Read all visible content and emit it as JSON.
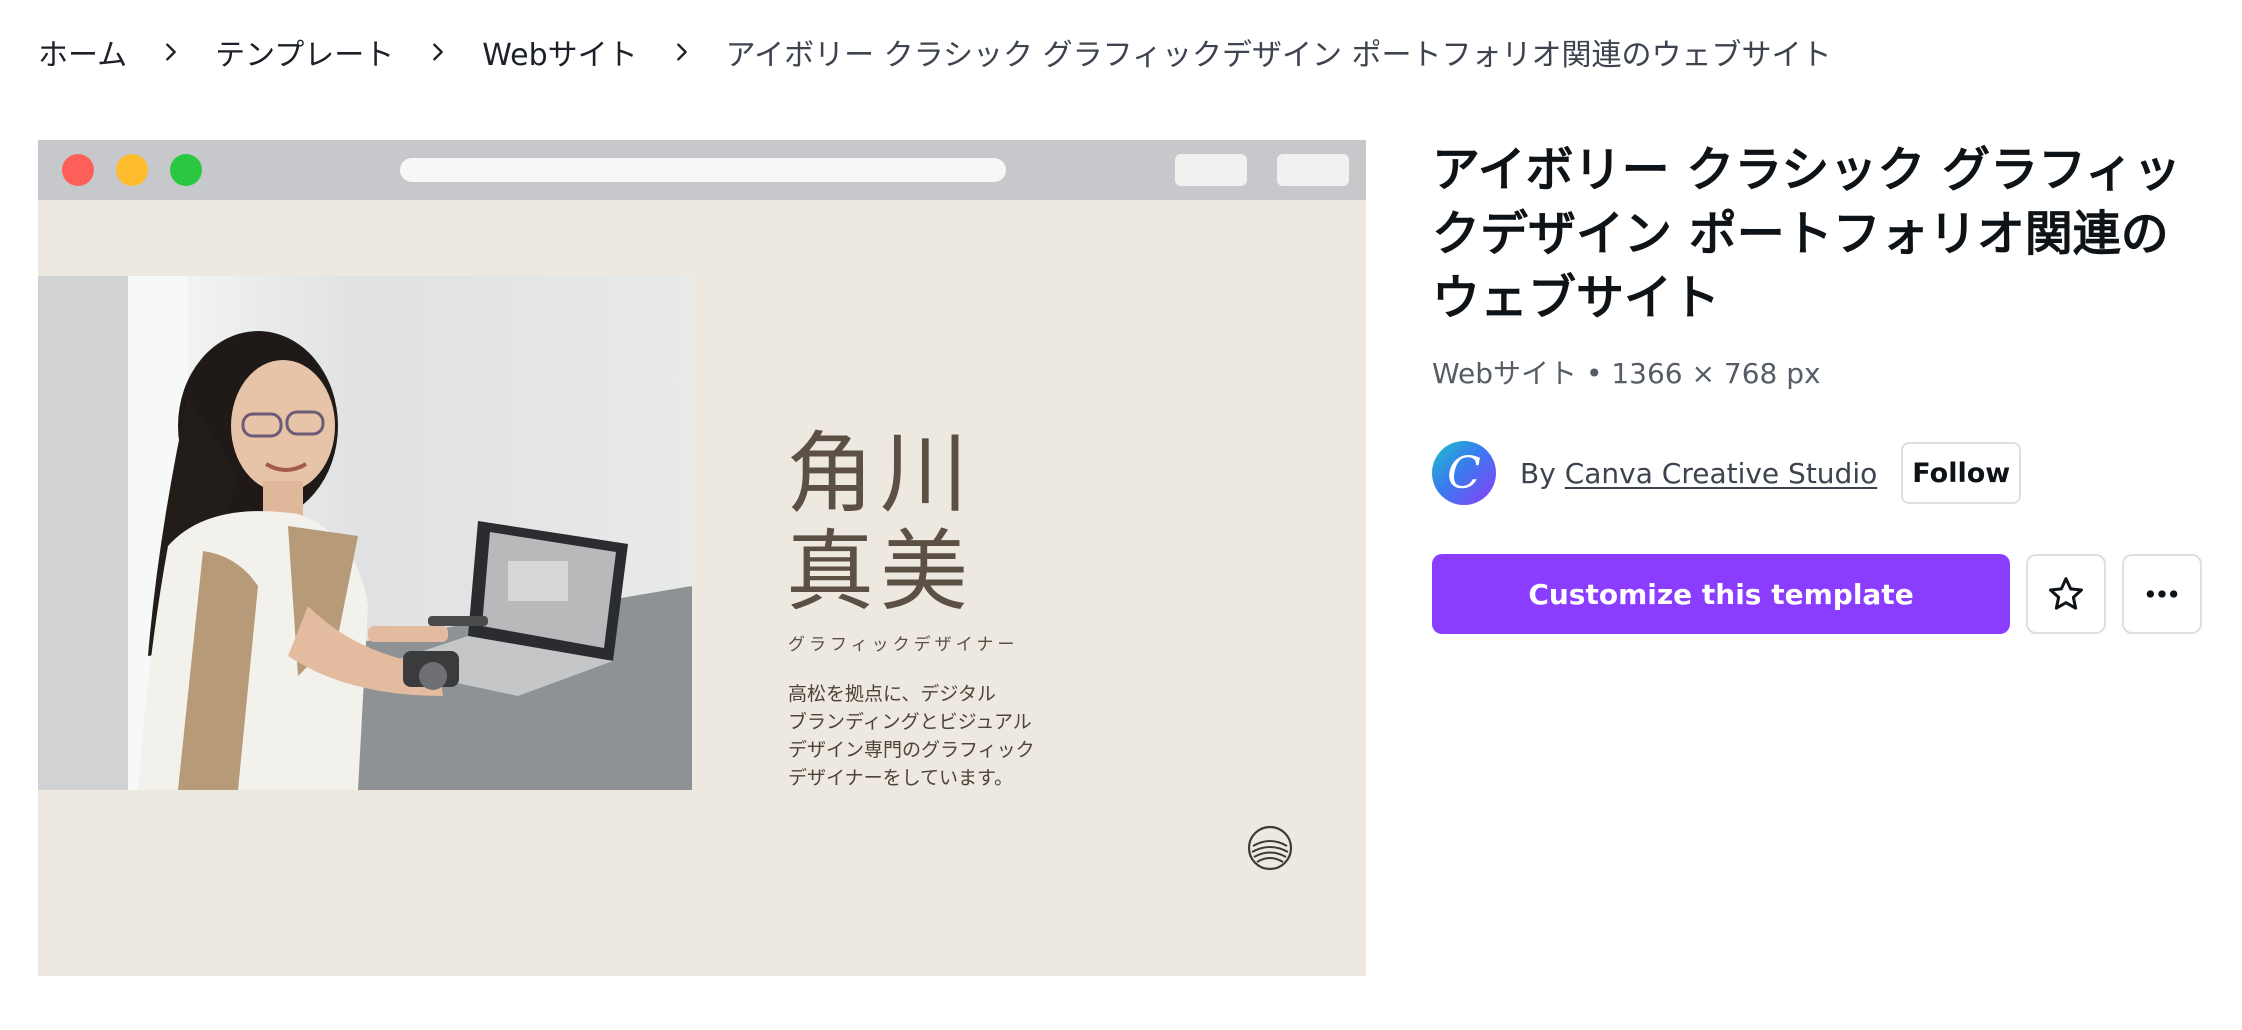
{
  "breadcrumb": {
    "items": [
      "ホーム",
      "テンプレート",
      "Webサイト",
      "アイボリー クラシック グラフィックデザイン ポートフォリオ関連のウェブサイト"
    ]
  },
  "preview": {
    "name_line1": "角川",
    "name_line2": "真美",
    "role": "グラフィックデザイナー",
    "bio_lines": [
      "高松を拠点に、デジタル",
      "ブランディングとビジュアル",
      "デザイン専門のグラフィック",
      "デザイナーをしています。"
    ]
  },
  "template": {
    "title_lines": [
      "アイボリー クラシック グラフィッ",
      "クデザイン ポートフォリオ関連の",
      "ウェブサイト"
    ],
    "meta": "Webサイト • 1366 × 768 px"
  },
  "author": {
    "avatar_letter": "C",
    "by": "By ",
    "name": "Canva Creative Studio",
    "follow_label": "Follow"
  },
  "actions": {
    "customize_label": "Customize this template",
    "favorite_icon": "star-icon",
    "more_icon": "more-horizontal-icon"
  },
  "colors": {
    "accent": "#8b3dff",
    "preview_bg": "#ede9e1",
    "preview_text": "#5c4f43"
  }
}
